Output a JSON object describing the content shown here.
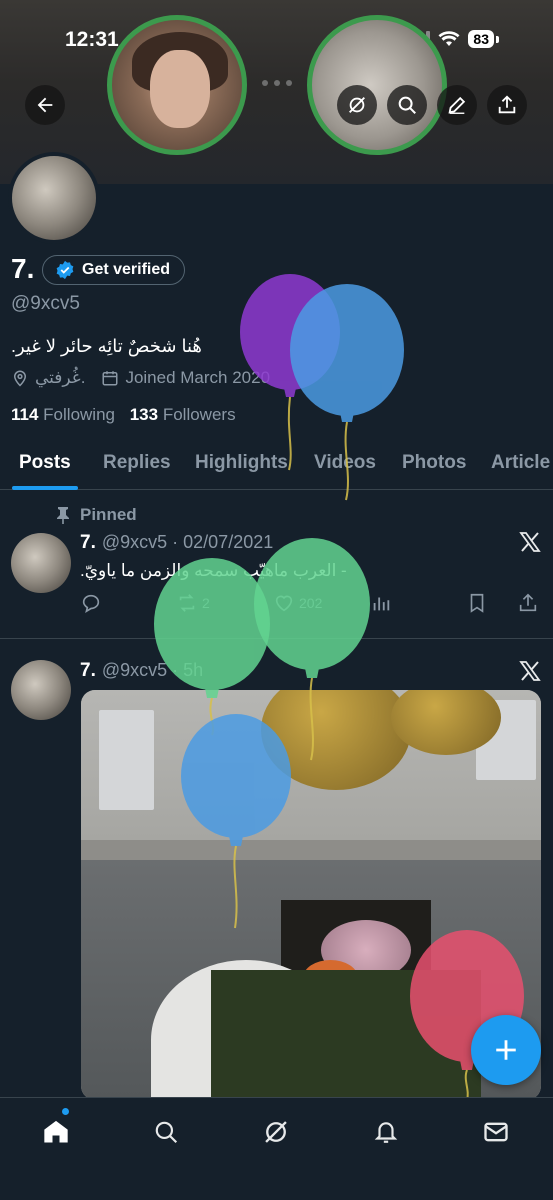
{
  "status_bar": {
    "time": "12:31",
    "battery": "83"
  },
  "profile": {
    "name": "7.",
    "verify_label": "Get verified",
    "handle": "@9xcv5",
    "bio": "هُنا شخصٌ تائِه حائر لا غير.",
    "location": "غُرفتي.",
    "joined": "Joined March 2020",
    "following_count": "114",
    "following_label": "Following",
    "followers_count": "133",
    "followers_label": "Followers"
  },
  "tabs": [
    "Posts",
    "Replies",
    "Highlights",
    "Videos",
    "Photos",
    "Article"
  ],
  "pinned_label": "Pinned",
  "posts": [
    {
      "name": "7.",
      "handle_date": "@9xcv5 · 02/07/2021",
      "text": "- العرب ماهيّب سمحه والزمن ما ياويّ.",
      "retweets": "2",
      "likes": "202"
    },
    {
      "name": "7.",
      "handle_date": "@9xcv5 · 5h"
    }
  ],
  "colors": {
    "background": "#15202b",
    "accent": "#1d9bf0",
    "spaces_ring": "#3c9a4d",
    "muted_text": "#8b98a5"
  },
  "icons": {
    "top": [
      "back-arrow-icon",
      "grok-icon",
      "search-icon",
      "edit-icon",
      "share-icon"
    ],
    "post_actions": [
      "reply-icon",
      "retweet-icon",
      "like-icon",
      "views-icon",
      "bookmark-icon",
      "share-icon"
    ],
    "bottom_nav": [
      "home-icon",
      "search-icon",
      "grok-icon",
      "notifications-icon",
      "messages-icon"
    ]
  }
}
